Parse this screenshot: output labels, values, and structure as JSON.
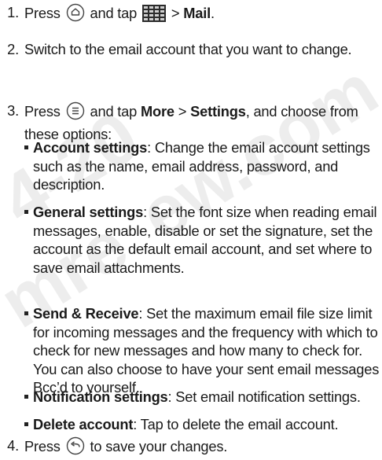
{
  "watermark": {
    "line1": "4-20",
    "line2": "mre",
    "line3": "ew.com"
  },
  "steps": [
    {
      "num": "1.",
      "press": "Press",
      "tap": "and tap",
      "sep": ">",
      "target": "Mail",
      "end": "."
    },
    {
      "num": "2.",
      "text": "Switch to the email account that you want to change."
    },
    {
      "num": "3.",
      "press": "Press",
      "tap": "and tap",
      "more": "More",
      "sep": ">",
      "settings": "Settings",
      "rest": ", and choose from these options:"
    },
    {
      "num": "4.",
      "press": "Press",
      "rest": "to save your changes."
    }
  ],
  "options": [
    {
      "title": "Account settings",
      "desc": ": Change the email account settings such as the name, email address, password, and description."
    },
    {
      "title": "General settings",
      "desc": ": Set the font size when reading email messages, enable, disable or set the signature, set the account as the default email account, and set where to save email attachments."
    },
    {
      "title": "Send & Receive",
      "desc": ": Set the maximum email file size limit for incoming messages and the frequency with which to check for new messages and how many to check for. You can also choose to have your sent email messages Bcc’d to yourself."
    },
    {
      "title": "Notification settings",
      "desc": ": Set email notification settings."
    },
    {
      "title": "Delete account",
      "desc": ": Tap to delete the email account."
    }
  ],
  "icons": {
    "home": "home-key-icon",
    "apps": "all-apps-grid-icon",
    "menu": "menu-key-icon",
    "back": "back-key-icon"
  }
}
